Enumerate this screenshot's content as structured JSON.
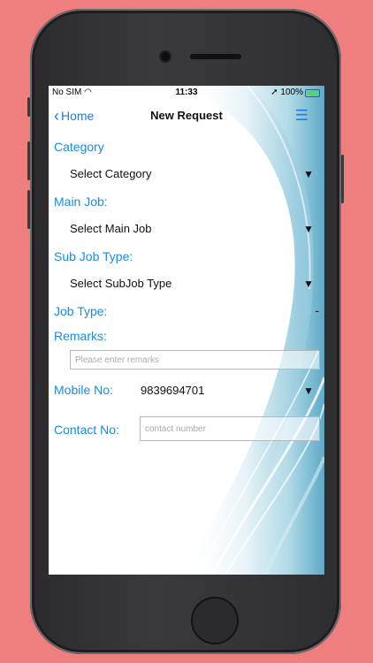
{
  "status": {
    "carrier": "No SIM",
    "time": "11:33",
    "battery": "100%"
  },
  "nav": {
    "back_label": "Home",
    "title": "New Request",
    "menu_icon": "hamburger-menu-icon"
  },
  "form": {
    "category_label": "Category",
    "category_value": "Select Category",
    "main_job_label": "Main Job:",
    "main_job_value": "Select Main Job",
    "sub_job_label": "Sub Job Type:",
    "sub_job_value": "Select SubJob Type",
    "job_type_label": "Job Type:",
    "job_type_value": "-",
    "remarks_label": "Remarks:",
    "remarks_placeholder": "Please enter remarks",
    "mobile_label": "Mobile No:",
    "mobile_value": "9839694701",
    "contact_label": "Contact No:",
    "contact_placeholder": "contact number"
  },
  "colors": {
    "accent": "#1a8be0",
    "background": "#ef7f7f"
  }
}
